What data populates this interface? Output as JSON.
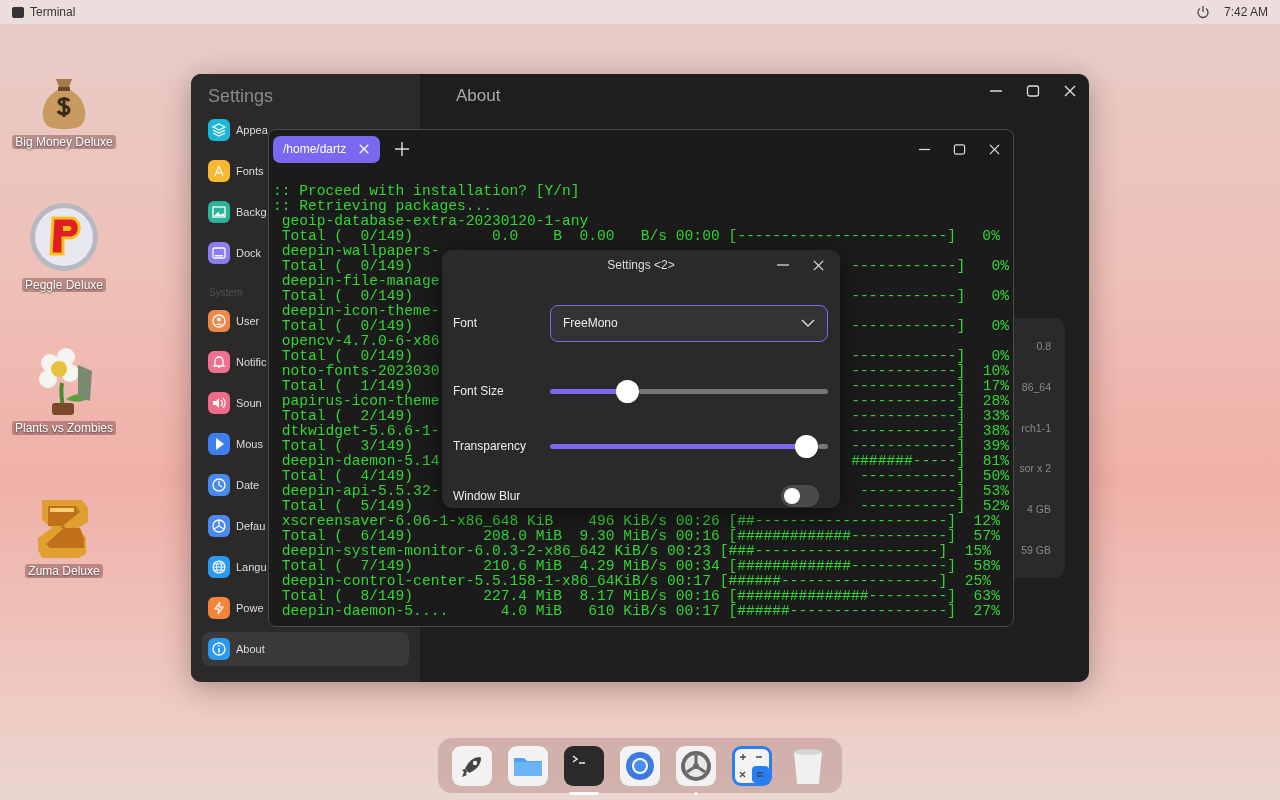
{
  "top_bar": {
    "app_name": "Terminal",
    "time": "7:42 AM"
  },
  "desktop_icons": [
    {
      "label": "Big Money Deluxe",
      "kind": "bag"
    },
    {
      "label": "Peggle Deluxe",
      "kind": "ball"
    },
    {
      "label": "Plants vs Zombies",
      "kind": "flower"
    },
    {
      "label": "Zuma Deluxe",
      "kind": "stone"
    }
  ],
  "settings_window": {
    "sidebar": {
      "title": "Settings",
      "groups": [
        {
          "items": [
            {
              "label": "Appea",
              "kind": "layers",
              "color": "#1cb8d8",
              "selected": false
            },
            {
              "label": "Fonts",
              "kind": "font",
              "glyph": "A",
              "color": "#f7b731",
              "selected": false
            },
            {
              "label": "Backg",
              "kind": "image",
              "color": "#2bb39a",
              "selected": false
            },
            {
              "label": "Dock",
              "kind": "dock",
              "color": "#8b7cf0",
              "selected": false
            }
          ]
        },
        {
          "label": "System",
          "items": [
            {
              "label": "User",
              "kind": "user",
              "color": "#ef8748",
              "selected": false
            },
            {
              "label": "Notific",
              "kind": "bell",
              "color": "#f0708f",
              "selected": false
            },
            {
              "label": "Soun",
              "kind": "speaker",
              "color": "#f06a8a",
              "selected": false
            },
            {
              "label": "Mous",
              "kind": "cursor",
              "color": "#3d7ff0",
              "selected": false
            },
            {
              "label": "Date",
              "kind": "clock",
              "color": "#4a8af0",
              "selected": false
            },
            {
              "label": "Defau",
              "kind": "wheel",
              "color": "#4a8af0",
              "selected": false
            },
            {
              "label": "Langu",
              "kind": "globe",
              "color": "#2a9af0",
              "selected": false
            },
            {
              "label": "Powe",
              "kind": "power",
              "color": "#f5843a",
              "selected": false
            },
            {
              "label": "About",
              "kind": "info",
              "color": "#2a9af0",
              "selected": true
            }
          ]
        }
      ]
    },
    "heading": "About",
    "info_values": [
      "0.8",
      "86_64",
      "rch1-1",
      "sor x 2",
      "4 GB",
      "59 GB"
    ]
  },
  "terminal": {
    "tabs": [
      {
        "label": "/home/dartz",
        "selected": true
      }
    ],
    "lines": [
      {
        "text": ":: Proceed with installation? [Y/n]"
      },
      {
        "text": ":: Retrieving packages..."
      },
      {
        "text": " geoip-database-extra-20230120-1-any"
      },
      {
        "text": " Total (  0/149)         0.0    B  0.00   B/s 00:00 [------------------------]   0%"
      },
      {
        "text": " deepin-wallpapers-"
      },
      {
        "text": " Total (  0/149)",
        "tail": "------------]   0%"
      },
      {
        "text": " deepin-file-manage"
      },
      {
        "text": " Total (  0/149)",
        "tail": "------------]   0%"
      },
      {
        "text": " deepin-icon-theme-"
      },
      {
        "text": " Total (  0/149)",
        "tail": "------------]   0%"
      },
      {
        "text": " opencv-4.7.0-6-x86"
      },
      {
        "text": " Total (  0/149)",
        "tail": "------------]   0%"
      },
      {
        "text": " noto-fonts-2023030",
        "tail": "------------]  10%"
      },
      {
        "text": " Total (  1/149)",
        "tail": "------------]  17%"
      },
      {
        "text": " papirus-icon-theme",
        "tail": "------------]  28%"
      },
      {
        "text": " Total (  2/149)",
        "tail": "------------]  33%"
      },
      {
        "text": " dtkwidget-5.6.6-1-",
        "tail": "------------]  38%"
      },
      {
        "text": " Total (  3/149)",
        "tail": "------------]  39%"
      },
      {
        "text": " deepin-daemon-5.14",
        "tail": "#######-----]  81%"
      },
      {
        "text": " Total (  4/149)",
        "tail": "-----------]  50%"
      },
      {
        "text": " deepin-api-5.5.32-",
        "tail": "-----------]  53%"
      },
      {
        "text": " Total (  5/149)",
        "tail": "-----------]  52%"
      },
      {
        "text": " xscreensaver-6.06-1-x86_648 KiB    496 KiB/s 00:26 [##----------------------]  12%"
      },
      {
        "text": " Total (  6/149)        208.0 MiB  9.30 MiB/s 00:16 [#############-----------]  57%"
      },
      {
        "text": " deepin-system-monitor-6.0.3-2-x86_642 KiB/s 00:23 [###---------------------]  15%"
      },
      {
        "text": " Total (  7/149)        210.6 MiB  4.29 MiB/s 00:34 [#############-----------]  58%"
      },
      {
        "text": " deepin-control-center-5.5.158-1-x86_64KiB/s 00:17 [######------------------]  25%"
      },
      {
        "text": " Total (  8/149)        227.4 MiB  8.17 MiB/s 00:16 [###############---------]  63%"
      },
      {
        "text": " deepin-daemon-5....      4.0 MiB   610 KiB/s 00:17 [######------------------]  27%"
      }
    ]
  },
  "dialog": {
    "title": "Settings <2>",
    "rows": [
      {
        "label": "Font",
        "kind": "dropdown",
        "value": "FreeMono"
      },
      {
        "label": "Font Size",
        "kind": "slider",
        "level": 0.26
      },
      {
        "label": "Transparency",
        "kind": "slider",
        "level": 0.96
      },
      {
        "label": "Window Blur",
        "kind": "toggle",
        "on": false
      }
    ]
  },
  "dock": [
    {
      "kind": "rocket",
      "focused": false,
      "running": false
    },
    {
      "kind": "folder",
      "focused": false,
      "running": false
    },
    {
      "kind": "terminal",
      "focused": true,
      "running": true
    },
    {
      "kind": "browser",
      "focused": false,
      "running": false
    },
    {
      "kind": "gear",
      "focused": false,
      "running": true
    },
    {
      "kind": "calculator",
      "focused": false,
      "running": false
    },
    {
      "kind": "trash",
      "focused": false,
      "running": false
    }
  ]
}
